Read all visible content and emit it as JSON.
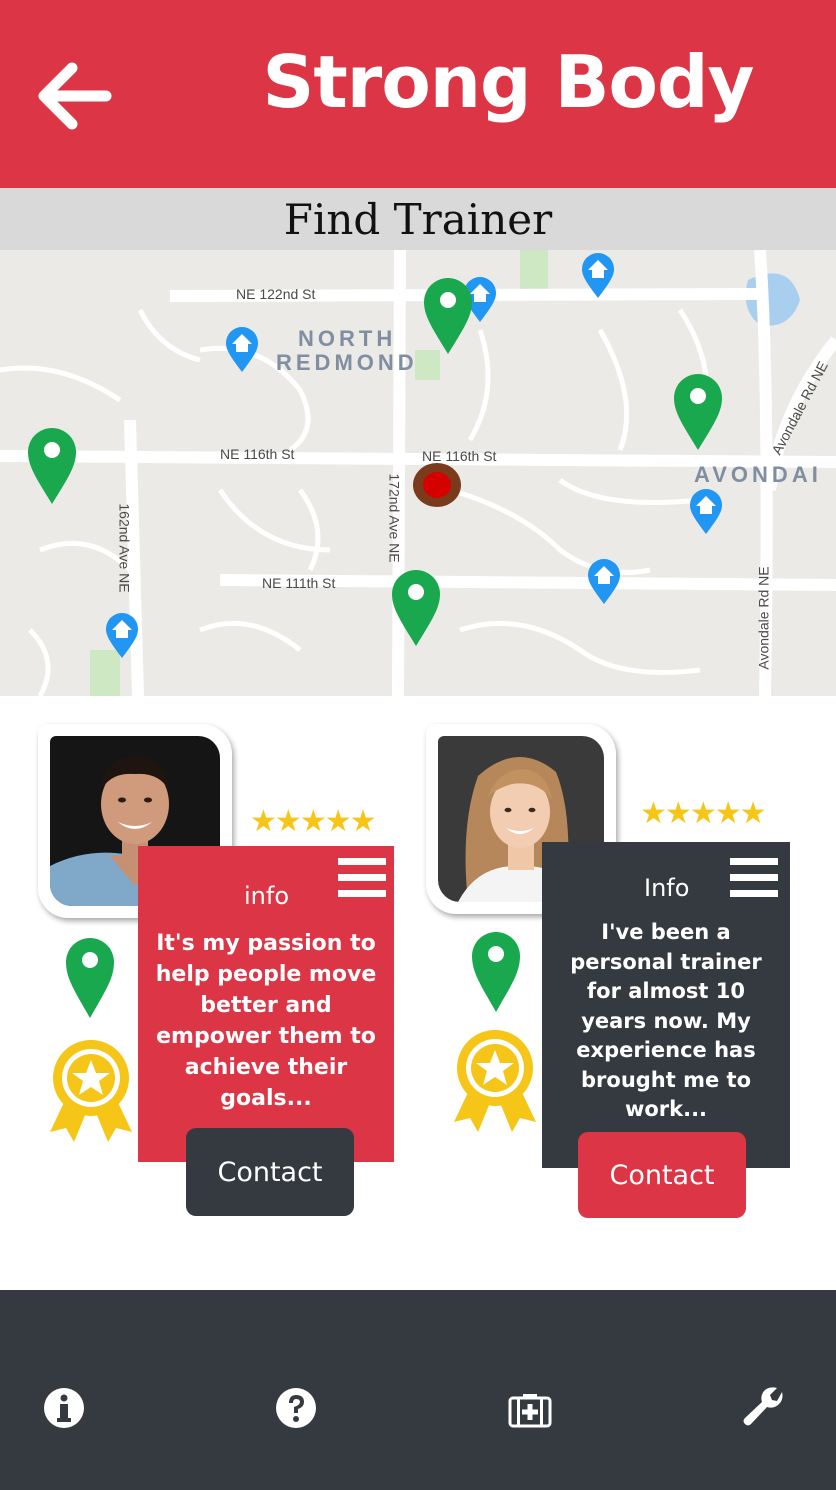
{
  "header": {
    "back_icon": "arrow-left-icon",
    "title": "Strong Body"
  },
  "subheader": {
    "title": "Find Trainer"
  },
  "map": {
    "road_labels": [
      "NE 122nd St",
      "NE 116th St",
      "NE 116th St",
      "NE 111th St",
      "162nd Ave NE",
      "172nd Ave NE",
      "Avondale Rd NE",
      "Avondale Rd NE"
    ],
    "area_labels": [
      "NORTH",
      "REDMOND",
      "AVONDAI"
    ],
    "trainer_pin_color": "#1aa84f",
    "home_pin_color": "#2196f3",
    "current_location_color": "#d50000"
  },
  "trainers": [
    {
      "rating": 5,
      "info_label": "info",
      "bio": "It's my passion to help people move better and empower them to achieve their goals...",
      "contact_label": "Contact",
      "panel_color": "#dc3545",
      "button_color": "#343a40"
    },
    {
      "rating": 5,
      "info_label": "Info",
      "bio": "I've been a personal trainer for almost 10 years now. My experience has brought me to work...",
      "contact_label": "Contact",
      "panel_color": "#343a40",
      "button_color": "#dc3545"
    }
  ],
  "bottom_nav": {
    "items": [
      "info-icon",
      "help-icon",
      "medical-kit-icon",
      "wrench-icon"
    ]
  },
  "colors": {
    "brand_red": "#dc3545",
    "dark": "#343a40",
    "award_gold": "#f5c518"
  }
}
